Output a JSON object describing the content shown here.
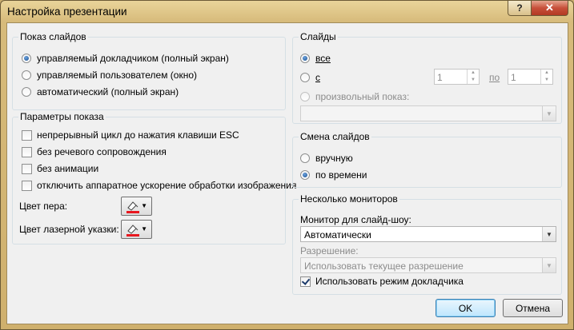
{
  "window": {
    "title": "Настройка презентации",
    "help_glyph": "?",
    "close_glyph": "✕"
  },
  "show_slides": {
    "title": "Показ слайдов",
    "options": [
      {
        "label": "управляемый докладчиком (полный экран)",
        "selected": true
      },
      {
        "label": "управляемый пользователем (окно)",
        "selected": false
      },
      {
        "label": "автоматический (полный экран)",
        "selected": false
      }
    ]
  },
  "show_options": {
    "title": "Параметры показа",
    "checkboxes": [
      {
        "label": "непрерывный цикл до нажатия клавиши ESC",
        "checked": false
      },
      {
        "label": "без речевого сопровождения",
        "checked": false
      },
      {
        "label": "без анимации",
        "checked": false
      },
      {
        "label": "отключить аппаратное ускорение обработки изображения",
        "checked": false
      }
    ],
    "pen_color_label": "Цвет пера:",
    "laser_color_label": "Цвет лазерной указки:",
    "dropdown_glyph": "▼"
  },
  "slides": {
    "title": "Слайды",
    "all_label": "все",
    "from_label": "с",
    "from_value": "1",
    "to_label": "по",
    "to_value": "1",
    "custom_label": "произвольный показ:",
    "custom_value": ""
  },
  "advance": {
    "title": "Смена слайдов",
    "manual_label": "вручную",
    "timed_label": "по времени",
    "selected": "timed"
  },
  "monitors": {
    "title": "Несколько мониторов",
    "monitor_label": "Монитор для слайд-шоу:",
    "monitor_value": "Автоматически",
    "resolution_label": "Разрешение:",
    "resolution_value": "Использовать текущее разрешение",
    "presenter_view_label": "Использовать режим докладчика",
    "presenter_view_checked": true
  },
  "buttons": {
    "ok": "OK",
    "cancel": "Отмена"
  },
  "colors": {
    "pen_red": "#e8171f",
    "accent_blue": "#1f4f8b",
    "titlebar_gold": "#d7bb7b"
  }
}
